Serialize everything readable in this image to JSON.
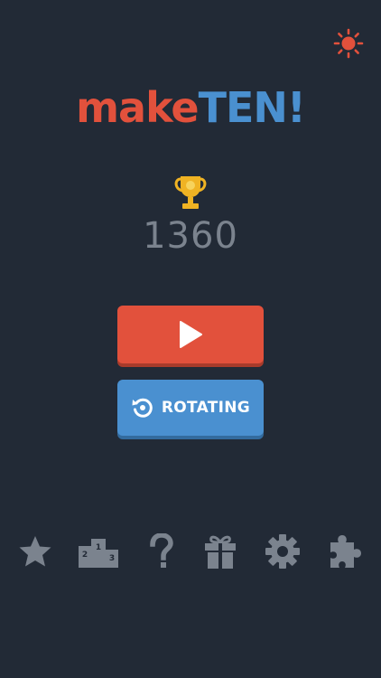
{
  "app": {
    "logo_part1": "make",
    "logo_part2": "TEN!",
    "logo_color1": "#e2513c",
    "logo_color2": "#4a90d0"
  },
  "header": {
    "theme_icon": "sun-icon",
    "theme_icon_color": "#e2513c"
  },
  "score": {
    "icon": "trophy-icon",
    "value": "1360"
  },
  "buttons": {
    "play": {
      "icon": "play-icon",
      "color": "#e2513c"
    },
    "rotating": {
      "icon": "rotate-icon",
      "label": "ROTATING",
      "color": "#4a90d0"
    }
  },
  "nav": {
    "icon_color": "#7b838e",
    "items": [
      {
        "icon": "star-icon"
      },
      {
        "icon": "leaderboard-icon",
        "podium_labels": [
          "2",
          "1",
          "3"
        ]
      },
      {
        "icon": "help-icon"
      },
      {
        "icon": "gift-icon"
      },
      {
        "icon": "settings-icon"
      },
      {
        "icon": "puzzle-icon"
      }
    ]
  }
}
